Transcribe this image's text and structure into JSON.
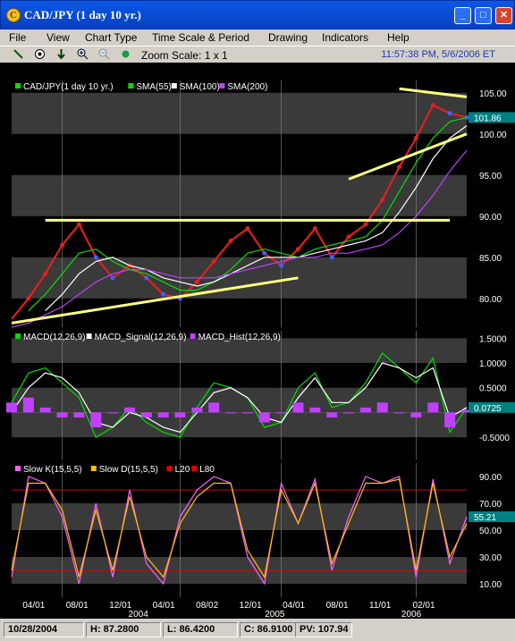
{
  "window": {
    "title": "CAD/JPY (1 day  10 yr.)",
    "app_icon_glyph": "C",
    "minimize": "_",
    "maximize": "□",
    "close": "✕"
  },
  "menu": [
    "File",
    "View",
    "Chart Type",
    "Time Scale & Period",
    "Drawing",
    "Indicators",
    "Help"
  ],
  "toolbar": {
    "zoom_label": "Zoom Scale: 1 x 1",
    "clock": "11:57:38 PM, 5/6/2006 ET",
    "icons": [
      "line-tool-icon",
      "target-icon",
      "arrow-down-icon",
      "zoom-in-icon",
      "zoom-out-icon",
      "green-dot-icon"
    ]
  },
  "status": {
    "date": "10/28/2004",
    "high": "H: 87.2800",
    "low": "L: 86.4200",
    "close": "C: 86.9100",
    "pv": "PV: 107.94"
  },
  "colors": {
    "background": "#000000",
    "band": "#3a3a3a",
    "price_up": "#e02020",
    "price_down": "#4060ff",
    "sma55": "#00e000",
    "sma100": "#ffffff",
    "sma200": "#c040ff",
    "trendline": "#ffff80",
    "macd": "#00e000",
    "macd_signal": "#ffffff",
    "macd_hist": "#c040ff",
    "slowk": "#ff60ff",
    "slowd": "#ffc000",
    "level_lines": "#e00000",
    "price_tag": "#008080"
  },
  "chart_data": [
    {
      "type": "line",
      "legend": [
        "CAD/JPY(1 day  10 yr.)",
        "SMA(55)",
        "SMA(100)",
        "SMA(200)"
      ],
      "ylim": [
        76.5,
        106.5
      ],
      "yticks": [
        80.0,
        85.0,
        90.0,
        95.0,
        100.0,
        105.0
      ],
      "last_value_tag": "101.86",
      "x": [
        "2004-02",
        "2004-03",
        "2004-04",
        "2004-05",
        "2004-06",
        "2004-07",
        "2004-08",
        "2004-09",
        "2004-10",
        "2004-11",
        "2004-12",
        "2005-01",
        "2005-02",
        "2005-03",
        "2005-04",
        "2005-05",
        "2005-06",
        "2005-07",
        "2005-08",
        "2005-09",
        "2005-10",
        "2005-11",
        "2005-12",
        "2006-01",
        "2006-02",
        "2006-03",
        "2006-04",
        "2006-05"
      ],
      "series": [
        {
          "name": "CAD/JPY(1 day  10 yr.)",
          "values": [
            77.5,
            80.0,
            83.0,
            86.5,
            89.0,
            85.0,
            82.5,
            84.0,
            82.5,
            80.5,
            80.0,
            82.0,
            84.5,
            87.0,
            88.5,
            85.5,
            84.0,
            86.0,
            88.5,
            85.0,
            87.5,
            89.0,
            92.0,
            96.0,
            99.5,
            103.5,
            102.5,
            102.0
          ]
        },
        {
          "name": "SMA(55)",
          "values": [
            null,
            78.5,
            80.5,
            83.0,
            85.5,
            86.0,
            84.5,
            83.5,
            83.0,
            82.0,
            81.0,
            81.0,
            82.0,
            83.5,
            85.5,
            86.0,
            85.5,
            85.0,
            86.0,
            86.5,
            87.0,
            87.5,
            89.5,
            93.0,
            96.5,
            99.5,
            101.5,
            102.0
          ]
        },
        {
          "name": "SMA(100)",
          "values": [
            null,
            null,
            78.5,
            80.5,
            83.0,
            84.5,
            85.0,
            84.0,
            83.5,
            82.5,
            82.0,
            81.5,
            82.0,
            83.0,
            84.0,
            85.0,
            85.0,
            85.0,
            85.5,
            86.0,
            86.5,
            87.0,
            88.0,
            90.5,
            93.5,
            97.0,
            99.5,
            101.0
          ]
        },
        {
          "name": "SMA(200)",
          "values": [
            76.5,
            77.0,
            78.0,
            79.0,
            80.5,
            82.0,
            83.0,
            83.5,
            83.5,
            83.0,
            82.5,
            82.5,
            82.5,
            83.0,
            83.5,
            84.0,
            84.5,
            85.0,
            85.0,
            85.5,
            85.5,
            86.0,
            86.5,
            88.0,
            90.0,
            92.5,
            95.5,
            98.0
          ]
        }
      ],
      "trendlines": [
        {
          "from": [
            "2004-02",
            77.0
          ],
          "to": [
            "2005-07",
            82.5
          ]
        },
        {
          "from": [
            "2004-04",
            89.5
          ],
          "to": [
            "2006-04",
            89.5
          ]
        },
        {
          "from": [
            "2005-10",
            94.5
          ],
          "to": [
            "2006-05",
            100.0
          ]
        },
        {
          "from": [
            "2006-01",
            105.5
          ],
          "to": [
            "2006-05",
            104.5
          ]
        }
      ]
    },
    {
      "type": "line",
      "legend": [
        "MACD(12,26,9)",
        "MACD_Signal(12,26,9)",
        "MACD_Hist(12,26,9)"
      ],
      "ylim": [
        -0.95,
        1.65
      ],
      "yticks": [
        -0.5,
        0.5,
        1.0,
        1.5
      ],
      "last_value_tag": "0.0725",
      "series": [
        {
          "name": "MACD(12,26,9)",
          "values": [
            0.2,
            0.8,
            0.9,
            0.6,
            0.3,
            -0.5,
            -0.3,
            0.1,
            -0.2,
            -0.4,
            -0.5,
            0.1,
            0.6,
            0.5,
            0.3,
            -0.3,
            -0.2,
            0.5,
            0.8,
            0.1,
            0.2,
            0.6,
            1.2,
            0.9,
            0.6,
            1.1,
            -0.4,
            0.1
          ]
        },
        {
          "name": "MACD_Signal(12,26,9)",
          "values": [
            0.0,
            0.5,
            0.8,
            0.7,
            0.4,
            -0.2,
            -0.3,
            0.0,
            -0.1,
            -0.3,
            -0.4,
            0.0,
            0.4,
            0.5,
            0.3,
            -0.1,
            -0.2,
            0.3,
            0.7,
            0.2,
            0.2,
            0.5,
            1.0,
            0.9,
            0.7,
            0.9,
            -0.1,
            0.1
          ]
        },
        {
          "name": "MACD_Hist(12,26,9)",
          "values": [
            0.2,
            0.3,
            0.1,
            -0.1,
            -0.1,
            -0.3,
            0.0,
            0.1,
            -0.1,
            -0.1,
            -0.1,
            0.1,
            0.2,
            0.0,
            0.0,
            -0.2,
            0.0,
            0.2,
            0.1,
            -0.1,
            0.0,
            0.1,
            0.2,
            0.0,
            -0.1,
            0.2,
            -0.3,
            0.05
          ]
        }
      ]
    },
    {
      "type": "line",
      "legend": [
        "Slow K(15,5,5)",
        "Slow D(15,5,5)",
        "L20",
        "L80"
      ],
      "ylim": [
        0,
        100
      ],
      "yticks": [
        10.0,
        30.0,
        50.0,
        70.0,
        90.0
      ],
      "last_value_tag": "55.21",
      "levels": [
        20,
        80
      ],
      "series": [
        {
          "name": "Slow K(15,5,5)",
          "values": [
            15,
            90,
            85,
            60,
            10,
            70,
            15,
            80,
            25,
            10,
            60,
            80,
            90,
            85,
            30,
            10,
            85,
            55,
            88,
            20,
            60,
            90,
            85,
            90,
            15,
            88,
            25,
            60
          ]
        },
        {
          "name": "Slow D(15,5,5)",
          "values": [
            20,
            85,
            85,
            65,
            15,
            65,
            20,
            75,
            30,
            15,
            55,
            75,
            85,
            85,
            35,
            15,
            80,
            55,
            85,
            25,
            55,
            85,
            85,
            88,
            20,
            85,
            30,
            55
          ]
        }
      ],
      "x_tick_labels": [
        "04/01",
        "08/01",
        "12/01",
        "04/01",
        "08/02",
        "12/01",
        "04/01",
        "08/01",
        "11/01",
        "02/01"
      ],
      "year_labels": [
        "2004",
        "2005",
        "2006"
      ]
    }
  ]
}
